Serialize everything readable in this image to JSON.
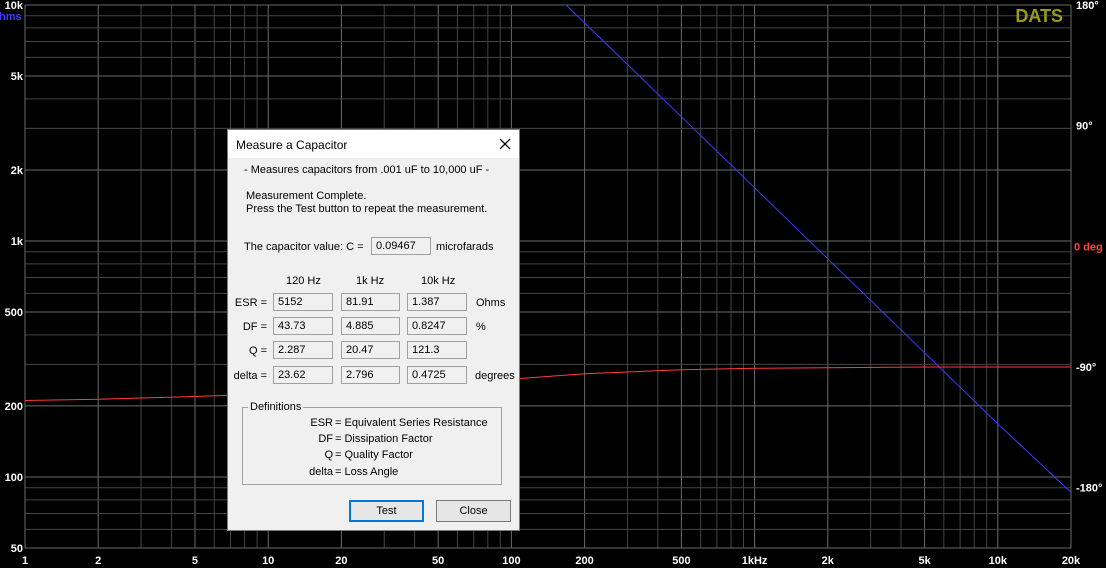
{
  "chart_data": {
    "type": "line",
    "x_scale": "log",
    "y_scale": "log",
    "xlim": [
      1,
      20000
    ],
    "ylim": [
      50,
      10000
    ],
    "y2lim": [
      -225,
      180
    ],
    "grid": true,
    "x_tick_labels": [
      {
        "value": 1,
        "label": "1"
      },
      {
        "value": 2,
        "label": "2"
      },
      {
        "value": 5,
        "label": "5"
      },
      {
        "value": 10,
        "label": "10"
      },
      {
        "value": 20,
        "label": "20"
      },
      {
        "value": 50,
        "label": "50"
      },
      {
        "value": 100,
        "label": "100"
      },
      {
        "value": 200,
        "label": "200"
      },
      {
        "value": 500,
        "label": "500"
      },
      {
        "value": 1000,
        "label": "1kHz"
      },
      {
        "value": 2000,
        "label": "2k"
      },
      {
        "value": 5000,
        "label": "5k"
      },
      {
        "value": 10000,
        "label": "10k"
      },
      {
        "value": 20000,
        "label": "20k"
      }
    ],
    "y_tick_labels": [
      {
        "value": 10000,
        "label": "10k"
      },
      {
        "value": 5000,
        "label": "5k"
      },
      {
        "value": 2000,
        "label": "2k"
      },
      {
        "value": 1000,
        "label": "1k"
      },
      {
        "value": 500,
        "label": "500"
      },
      {
        "value": 200,
        "label": "200"
      },
      {
        "value": 100,
        "label": "100"
      },
      {
        "value": 50,
        "label": "50"
      }
    ],
    "y2_tick_labels": [
      {
        "value": 180,
        "label": "180°"
      },
      {
        "value": 90,
        "label": "90°"
      },
      {
        "value": -90,
        "label": "-90°"
      },
      {
        "value": -180,
        "label": "-180°"
      }
    ],
    "y2_zero_label": "0 deg",
    "ylabel": "hms",
    "watermark": "DATS",
    "series": [
      {
        "color": "#3b3bff",
        "axis": "left",
        "x": [
          160,
          200,
          300,
          500,
          800,
          1000,
          2000,
          5000,
          10000,
          20000
        ],
        "y": [
          10500,
          8400,
          5600,
          3360,
          2100,
          1680,
          840,
          336,
          168,
          86
        ]
      },
      {
        "color": "#ff3b3b",
        "axis": "right",
        "x": [
          1,
          2,
          5,
          10,
          20,
          50,
          100,
          200,
          500,
          1000,
          2000,
          5000,
          10000,
          20000
        ],
        "y": [
          -115,
          -114,
          -112,
          -110,
          -107,
          -103,
          -99,
          -95,
          -92,
          -91,
          -90.5,
          -90,
          -90,
          -90
        ]
      }
    ]
  },
  "dialog": {
    "title": "Measure a Capacitor",
    "subtitle": "- Measures capacitors from .001 uF to 10,000 uF -",
    "status_line1": "Measurement Complete.",
    "status_line2": "Press the Test button to repeat the measurement.",
    "cap_label": "The capacitor value:  C =",
    "cap_value": "0.09467",
    "cap_unit": "microfarads",
    "col_headers": [
      "120 Hz",
      "1k Hz",
      "10k Hz"
    ],
    "rows": [
      {
        "label": "ESR =",
        "values": [
          "5152",
          "81.91",
          "1.387"
        ],
        "unit": "Ohms"
      },
      {
        "label": "DF =",
        "values": [
          "43.73",
          "4.885",
          "0.8247"
        ],
        "unit": "%"
      },
      {
        "label": "Q =",
        "values": [
          "2.287",
          "20.47",
          "121.3"
        ],
        "unit": ""
      },
      {
        "label": "delta =",
        "values": [
          "23.62",
          "2.796",
          "0.4725"
        ],
        "unit": "degrees"
      }
    ],
    "definitions_title": "Definitions",
    "definitions": [
      {
        "key": "ESR",
        "text": "= Equivalent Series Resistance"
      },
      {
        "key": "DF",
        "text": "= Dissipation Factor"
      },
      {
        "key": "Q",
        "text": "= Quality Factor"
      },
      {
        "key": "delta",
        "text": "= Loss Angle"
      }
    ],
    "test_label": "Test",
    "close_label": "Close"
  },
  "colors": {
    "background": "#000000",
    "grid": "#444444",
    "grid_major": "#6a6a6a",
    "axis_text": "#ffffff",
    "magnitude_trace": "#3b3bff",
    "phase_trace": "#ff3b3b",
    "phase_axis_label": "#ff4040",
    "watermark": "#9a9a1a"
  }
}
